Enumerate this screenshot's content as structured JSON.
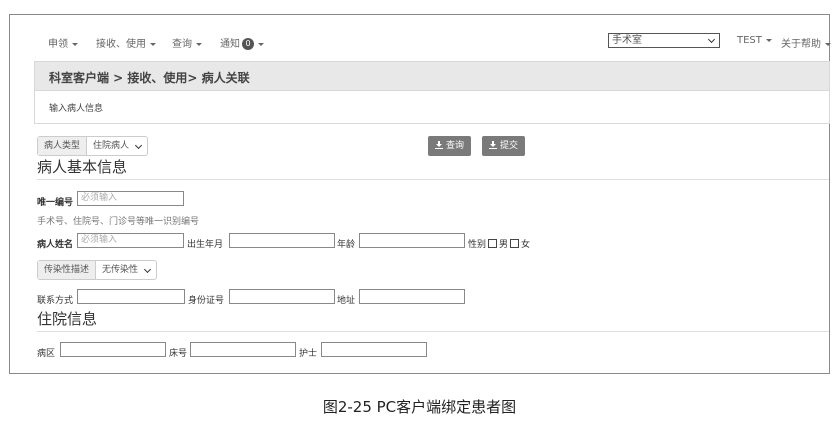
{
  "nav": {
    "items": [
      {
        "label": "申领",
        "dropdown": true
      },
      {
        "label": "接收、使用",
        "dropdown": true
      },
      {
        "label": "查询",
        "dropdown": true
      },
      {
        "label": "通知",
        "badge": "0",
        "dropdown": true
      }
    ],
    "select_value": "手术室",
    "user": "TEST",
    "help": "关于帮助"
  },
  "breadcrumb": "科室客户端 > 接收、使用> 病人关联",
  "panel_text": "输入病人信息",
  "patient_type": {
    "label": "病人类型",
    "value": "住院病人"
  },
  "buttons": {
    "query": "查询",
    "submit": "提交"
  },
  "basic_info": {
    "title": "病人基本信息",
    "unique_no": {
      "label": "唯一编号",
      "placeholder": "必须输入"
    },
    "hint": "手术号、住院号、门诊号等唯一识别编号",
    "name": {
      "label": "病人姓名",
      "placeholder": "必须输入"
    },
    "birth": {
      "label": "出生年月"
    },
    "age": {
      "label": "年龄"
    },
    "gender": {
      "label": "性别",
      "male": "男",
      "female": "女"
    },
    "infection": {
      "label": "传染性描述",
      "value": "无传染性"
    },
    "contact": {
      "label": "联系方式"
    },
    "id_card": {
      "label": "身份证号"
    },
    "address": {
      "label": "地址"
    }
  },
  "hospital_info": {
    "title": "住院信息",
    "ward": {
      "label": "病区"
    },
    "bed": {
      "label": "床号"
    },
    "nurse": {
      "label": "护士"
    }
  },
  "caption": "图2-25   PC客户端绑定患者图"
}
